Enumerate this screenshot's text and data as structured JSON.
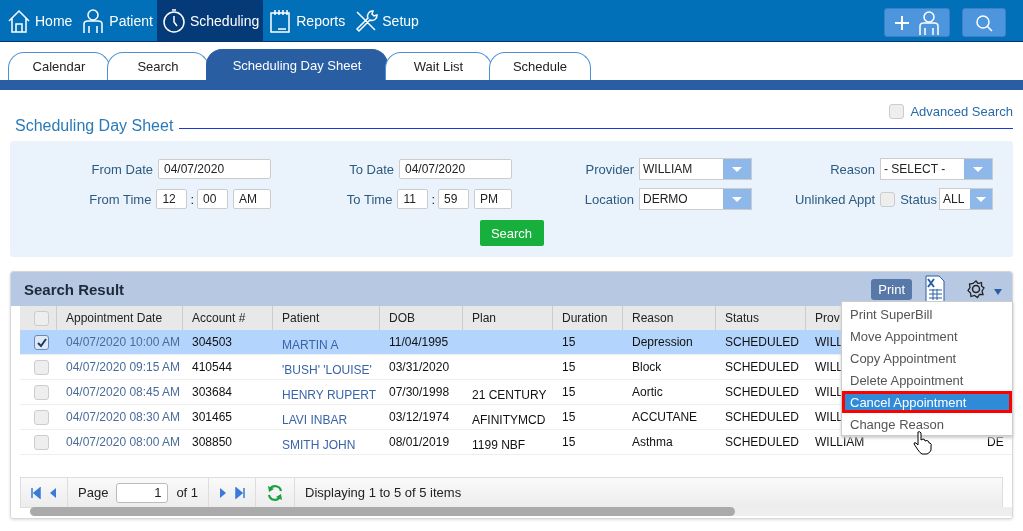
{
  "nav": {
    "items": [
      {
        "label": "Home",
        "selected": false
      },
      {
        "label": "Patient",
        "selected": false
      },
      {
        "label": "Scheduling",
        "selected": true
      },
      {
        "label": "Reports",
        "selected": false
      },
      {
        "label": "Setup",
        "selected": false
      }
    ],
    "actions": [
      {
        "kind": "add_patient"
      },
      {
        "kind": "search"
      }
    ]
  },
  "tabs": [
    {
      "label": "Calendar",
      "selected": false
    },
    {
      "label": "Search",
      "selected": false
    },
    {
      "label": "Scheduling Day Sheet",
      "selected": true
    },
    {
      "label": "Wait List",
      "selected": false
    },
    {
      "label": "Schedule",
      "selected": false
    }
  ],
  "page": {
    "title": "Scheduling Day Sheet",
    "advanced_search": {
      "label": "Advanced Search",
      "checked": false
    }
  },
  "filters": {
    "items": [
      {
        "label": "From Date",
        "kind": "date",
        "value": "04/07/2020"
      },
      {
        "label": "To Date",
        "kind": "date",
        "value": "04/07/2020"
      },
      {
        "label": "Provider",
        "kind": "select",
        "value": "WILLIAM"
      },
      {
        "label": "Reason",
        "kind": "select",
        "value": "- SELECT -"
      },
      {
        "label": "From Time",
        "kind": "time",
        "hour": "12",
        "separator": ":",
        "minute": "00",
        "period": "AM"
      },
      {
        "label": "To Time",
        "kind": "time",
        "hour": "11",
        "separator": ":",
        "minute": "59",
        "period": "PM"
      },
      {
        "label": "Location",
        "kind": "select",
        "value": "DERMO"
      },
      {
        "label": "Unlinked Appt",
        "kind": "check_status",
        "checked": false,
        "status_label": "Status",
        "value": "ALL"
      }
    ],
    "button": "Search"
  },
  "results": {
    "title": "Search Result",
    "print": "Print",
    "all_checked": false,
    "columns": [
      "Appointment Date",
      "Account #",
      "Patient",
      "DOB",
      "Plan",
      "Duration",
      "Reason",
      "Status",
      "Prov"
    ],
    "rows": [
      {
        "selected": true,
        "checked": true,
        "appointment_date": "04/07/2020 10:00 AM",
        "account": "304503",
        "patient": "MARTIN A",
        "dob": "11/04/1995",
        "duration": "15",
        "reason": "Depression",
        "status": "SCHEDULED",
        "provider": "WILL"
      },
      {
        "selected": false,
        "checked": false,
        "appointment_date": "04/07/2020 09:15 AM",
        "account": "410544",
        "patient": "'BUSH' 'LOUISE'",
        "dob": "03/31/2020",
        "duration": "15",
        "reason": "Block",
        "status": "SCHEDULED",
        "provider": "WILL"
      },
      {
        "selected": false,
        "checked": false,
        "appointment_date": "04/07/2020 08:45 AM",
        "account": "303684",
        "patient": "HENRY RUPERT",
        "dob": "07/30/1998",
        "plan": "21 CENTURY",
        "duration": "15",
        "reason": "Aortic",
        "status": "SCHEDULED",
        "provider": "WILL"
      },
      {
        "selected": false,
        "checked": false,
        "appointment_date": "04/07/2020 08:30 AM",
        "account": "301465",
        "patient": "LAVI INBAR",
        "dob": "03/12/1974",
        "plan": "AFINITYMCD",
        "duration": "15",
        "reason": "ACCUTANE",
        "status": "SCHEDULED",
        "provider": "WILL"
      },
      {
        "selected": false,
        "checked": false,
        "appointment_date": "04/07/2020 08:00 AM",
        "account": "308850",
        "patient": "SMITH JOHN",
        "dob": "08/01/2019",
        "plan": "1199 NBF",
        "duration": "15",
        "reason": "Asthma",
        "status": "SCHEDULED",
        "provider": "WILLIAM",
        "column_10": "DE"
      }
    ],
    "menu": [
      {
        "label": "Print SuperBill",
        "selected": false
      },
      {
        "label": "Move Appointment",
        "selected": false
      },
      {
        "label": "Copy Appointment",
        "selected": false
      },
      {
        "label": "Delete Appointment",
        "selected": false
      },
      {
        "label": "Cancel Appointment",
        "selected": true
      },
      {
        "label": "Change Reason",
        "selected": false
      }
    ],
    "pager": {
      "page_label": "Page",
      "page": "1",
      "of": "of 1",
      "info": "Displaying 1 to 5 of 5 items"
    }
  }
}
